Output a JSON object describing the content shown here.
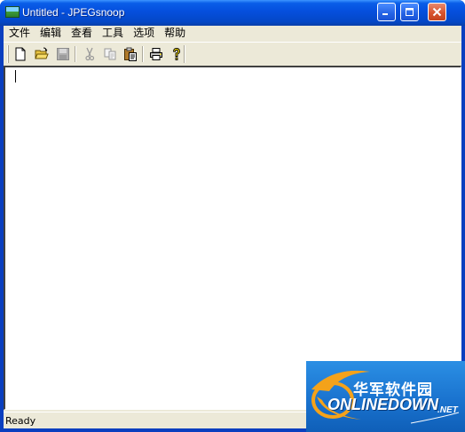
{
  "window": {
    "title": "Untitled - JPEGsnoop"
  },
  "menubar": {
    "items": [
      {
        "label": "文件"
      },
      {
        "label": "编辑"
      },
      {
        "label": "查看"
      },
      {
        "label": "工具"
      },
      {
        "label": "选项"
      },
      {
        "label": "帮助"
      }
    ]
  },
  "toolbar": {
    "buttons": [
      {
        "icon": "new-document-icon",
        "enabled": true
      },
      {
        "icon": "open-folder-icon",
        "enabled": true
      },
      {
        "icon": "save-disk-icon",
        "enabled": false
      },
      {
        "icon": "cut-scissors-icon",
        "enabled": false
      },
      {
        "icon": "copy-icon",
        "enabled": false
      },
      {
        "icon": "paste-clipboard-icon",
        "enabled": true
      },
      {
        "icon": "print-icon",
        "enabled": true
      },
      {
        "icon": "help-question-icon",
        "enabled": true
      }
    ]
  },
  "editor": {
    "content": ""
  },
  "statusbar": {
    "text": "Ready"
  },
  "watermark": {
    "cn_text": "华军软件园",
    "en_text": "ONLINEDOWN",
    "suffix": ".NET"
  },
  "colors": {
    "titlebar": "#0550df",
    "client": "#ece9d8",
    "close_button": "#d8542e",
    "watermark_bg": "#1a73cf"
  }
}
